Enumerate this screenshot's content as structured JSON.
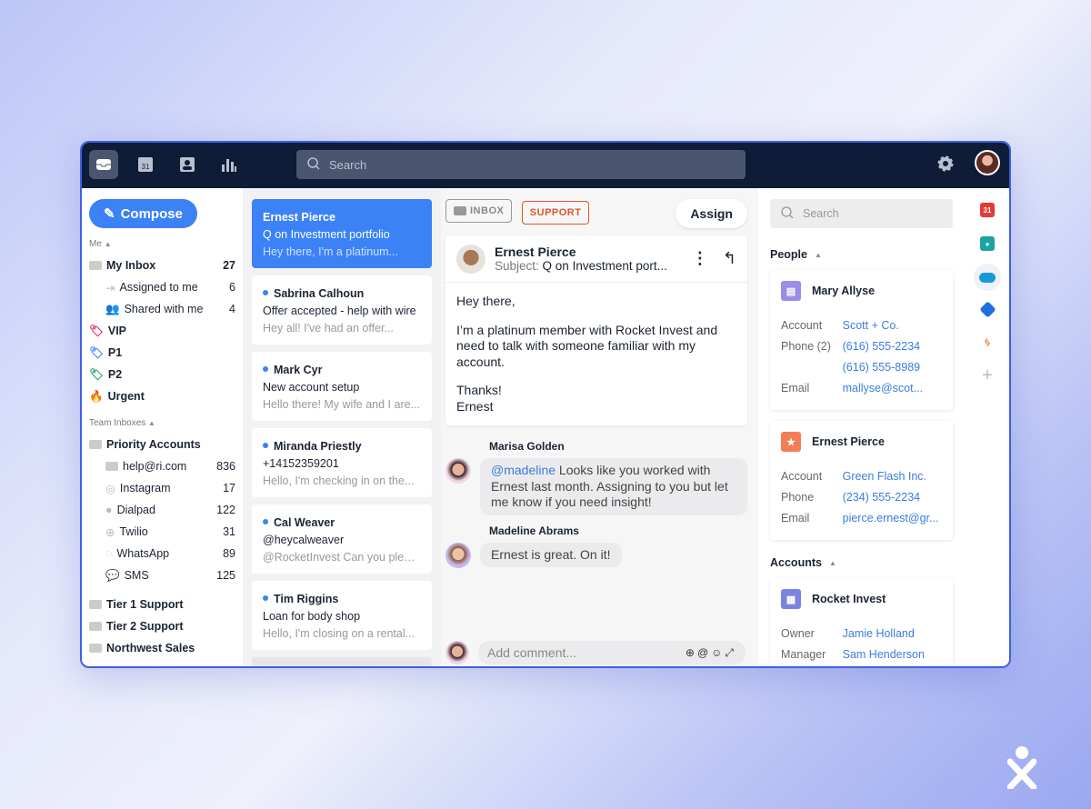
{
  "topbar": {
    "search_placeholder": "Search",
    "nav": [
      "inbox-icon",
      "calendar-icon",
      "contacts-icon",
      "analytics-icon"
    ],
    "calendar_day": "31"
  },
  "sidebar": {
    "compose": "Compose",
    "me_label": "Me",
    "me_items": [
      {
        "label": "My Inbox",
        "count": "27"
      },
      {
        "label": "Assigned to me",
        "count": "6"
      },
      {
        "label": "Shared with me",
        "count": "4"
      }
    ],
    "tags": [
      {
        "label": "VIP",
        "color": "#e0245e"
      },
      {
        "label": "P1",
        "color": "#3b82f6"
      },
      {
        "label": "P2",
        "color": "#22a06b"
      }
    ],
    "urgent": "Urgent",
    "team_label": "Team Inboxes",
    "team_parent": "Priority Accounts",
    "channels": [
      {
        "label": "help@ri.com",
        "count": "836"
      },
      {
        "label": "Instagram",
        "count": "17"
      },
      {
        "label": "Dialpad",
        "count": "122"
      },
      {
        "label": "Twilio",
        "count": "31"
      },
      {
        "label": "WhatsApp",
        "count": "89"
      },
      {
        "label": "SMS",
        "count": "125"
      }
    ],
    "other_inboxes": [
      "Tier 1 Support",
      "Tier 2 Support",
      "Northwest Sales"
    ]
  },
  "list": [
    {
      "name": "Ernest Pierce",
      "subject": "Q on Investment portfolio",
      "preview": "Hey there, I'm a platinum...",
      "selected": true
    },
    {
      "name": "Sabrina Calhoun",
      "subject": "Offer accepted - help with wire",
      "preview": "Hey all! I've had an offer..."
    },
    {
      "name": "Mark Cyr",
      "subject": "New account setup",
      "preview": "Hello there! My wife and I are..."
    },
    {
      "name": "Miranda Priestly",
      "subject": "+14152359201",
      "preview": "Hello, I'm checking in on the..."
    },
    {
      "name": "Cal Weaver",
      "subject": "@heycalweaver",
      "preview": "@RocketInvest Can you pleas..."
    },
    {
      "name": "Tim Riggins",
      "subject": "Loan for body shop",
      "preview": "Hello, I'm closing on a rental..."
    }
  ],
  "conversation": {
    "tag_inbox": "INBOX",
    "tag_support": "SUPPORT",
    "assign": "Assign",
    "from": "Ernest Pierce",
    "subject_label": "Subject:",
    "subject": "Q on Investment port...",
    "body": [
      "Hey there,",
      "I’m a platinum member with Rocket Invest and need to talk with someone familiar with my account."
    ],
    "signoff": "Thanks!",
    "signature": "Ernest",
    "comments": [
      {
        "author": "Marisa Golden",
        "mention": "@madeline",
        "text": " Looks like you worked with Ernest last month. Assigning to you but let me know if you need insight!"
      },
      {
        "author": "Madeline Abrams",
        "text": "Ernest is great. On it!"
      }
    ],
    "comment_placeholder": "Add comment..."
  },
  "right": {
    "search_placeholder": "Search",
    "people_label": "People",
    "people": [
      {
        "name": "Mary Allyse",
        "icon_color": "#9b8ce8",
        "fields": [
          {
            "k": "Account",
            "v": "Scott + Co."
          },
          {
            "k": "Phone (2)",
            "v": "(616) 555-2234"
          },
          {
            "k": "",
            "v": "(616) 555-8989"
          },
          {
            "k": "Email",
            "v": "mallyse@scot..."
          }
        ]
      },
      {
        "name": "Ernest Pierce",
        "icon_color": "#f47c56",
        "fields": [
          {
            "k": "Account",
            "v": "Green Flash Inc."
          },
          {
            "k": "Phone",
            "v": "(234) 555-2234"
          },
          {
            "k": "Email",
            "v": "pierce.ernest@gr..."
          }
        ]
      }
    ],
    "accounts_label": "Accounts",
    "account": {
      "name": "Rocket Invest",
      "icon_color": "#7a84e0",
      "fields": [
        {
          "k": "Owner",
          "v": "Jamie Holland"
        },
        {
          "k": "Manager",
          "v": "Sam Henderson"
        }
      ]
    }
  },
  "rail": [
    "google-calendar-icon",
    "contacts-app-icon",
    "salesforce-icon",
    "jira-icon",
    "hubspot-icon",
    "add-app-icon"
  ],
  "colors": {
    "accent": "#3b82f6",
    "topbar": "#0e1c38",
    "support_tag": "#e0562a"
  }
}
